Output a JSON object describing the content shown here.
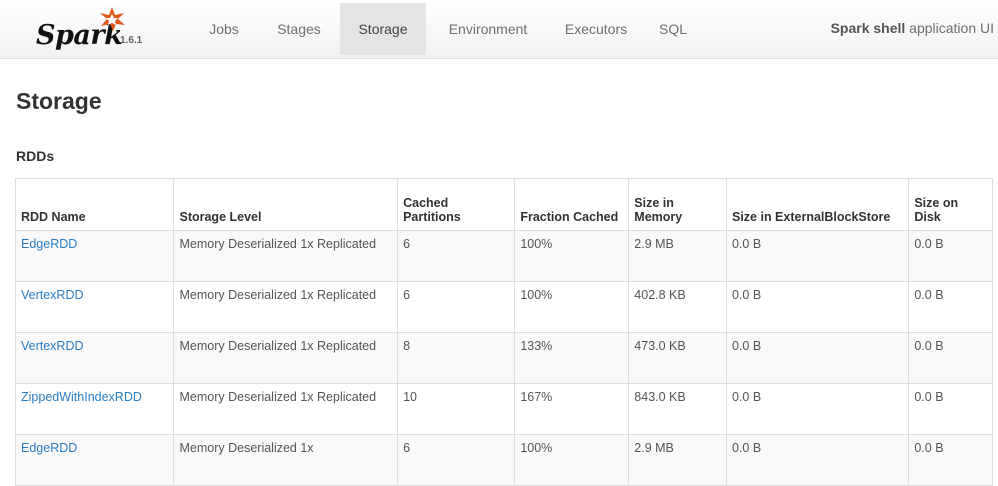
{
  "brand": {
    "name": "Spark",
    "version": "1.6.1"
  },
  "nav": {
    "tabs": [
      {
        "label": "Jobs"
      },
      {
        "label": "Stages"
      },
      {
        "label": "Storage"
      },
      {
        "label": "Environment"
      },
      {
        "label": "Executors"
      },
      {
        "label": "SQL"
      }
    ],
    "active_tab": "Storage",
    "app_name": "Spark shell",
    "app_suffix": "application UI"
  },
  "page": {
    "title": "Storage",
    "section": "RDDs"
  },
  "table": {
    "headers": {
      "name": "RDD Name",
      "level": "Storage Level",
      "cached_partitions": "Cached Partitions",
      "fraction_cached": "Fraction Cached",
      "size_memory": "Size in Memory",
      "size_external": "Size in ExternalBlockStore",
      "size_disk": "Size on Disk"
    },
    "rows": [
      {
        "name": "EdgeRDD",
        "level": "Memory Deserialized 1x Replicated",
        "cached_partitions": "6",
        "fraction_cached": "100%",
        "size_memory": "2.9 MB",
        "size_external": "0.0 B",
        "size_disk": "0.0 B"
      },
      {
        "name": "VertexRDD",
        "level": "Memory Deserialized 1x Replicated",
        "cached_partitions": "6",
        "fraction_cached": "100%",
        "size_memory": "402.8 KB",
        "size_external": "0.0 B",
        "size_disk": "0.0 B"
      },
      {
        "name": "VertexRDD",
        "level": "Memory Deserialized 1x Replicated",
        "cached_partitions": "8",
        "fraction_cached": "133%",
        "size_memory": "473.0 KB",
        "size_external": "0.0 B",
        "size_disk": "0.0 B"
      },
      {
        "name": "ZippedWithIndexRDD",
        "level": "Memory Deserialized 1x Replicated",
        "cached_partitions": "10",
        "fraction_cached": "167%",
        "size_memory": "843.0 KB",
        "size_external": "0.0 B",
        "size_disk": "0.0 B"
      },
      {
        "name": "EdgeRDD",
        "level": "Memory Deserialized 1x",
        "cached_partitions": "6",
        "fraction_cached": "100%",
        "size_memory": "2.9 MB",
        "size_external": "0.0 B",
        "size_disk": "0.0 B"
      }
    ]
  },
  "colors": {
    "link": "#2a7cc3",
    "spark_star": "#e25a1c",
    "active_tab_bg": "#e4e4e4"
  },
  "icons": {
    "brand_logo": "spark-star-icon"
  }
}
